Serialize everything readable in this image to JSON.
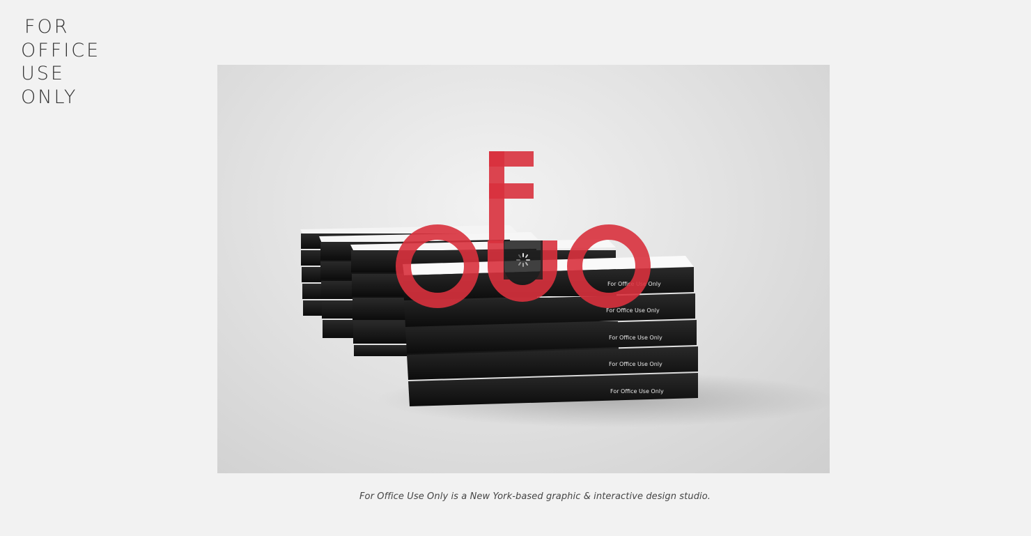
{
  "header": {
    "logo_lines": [
      "FOR",
      "OFFICE",
      "USE",
      "ONLY"
    ]
  },
  "hero": {
    "box_label": "For Office Use Only",
    "logo_text": "oFUo",
    "overlay_color": "#d8313d",
    "loading": true
  },
  "footer": {
    "tagline": "For Office Use Only is a New York-based graphic & interactive design studio."
  }
}
